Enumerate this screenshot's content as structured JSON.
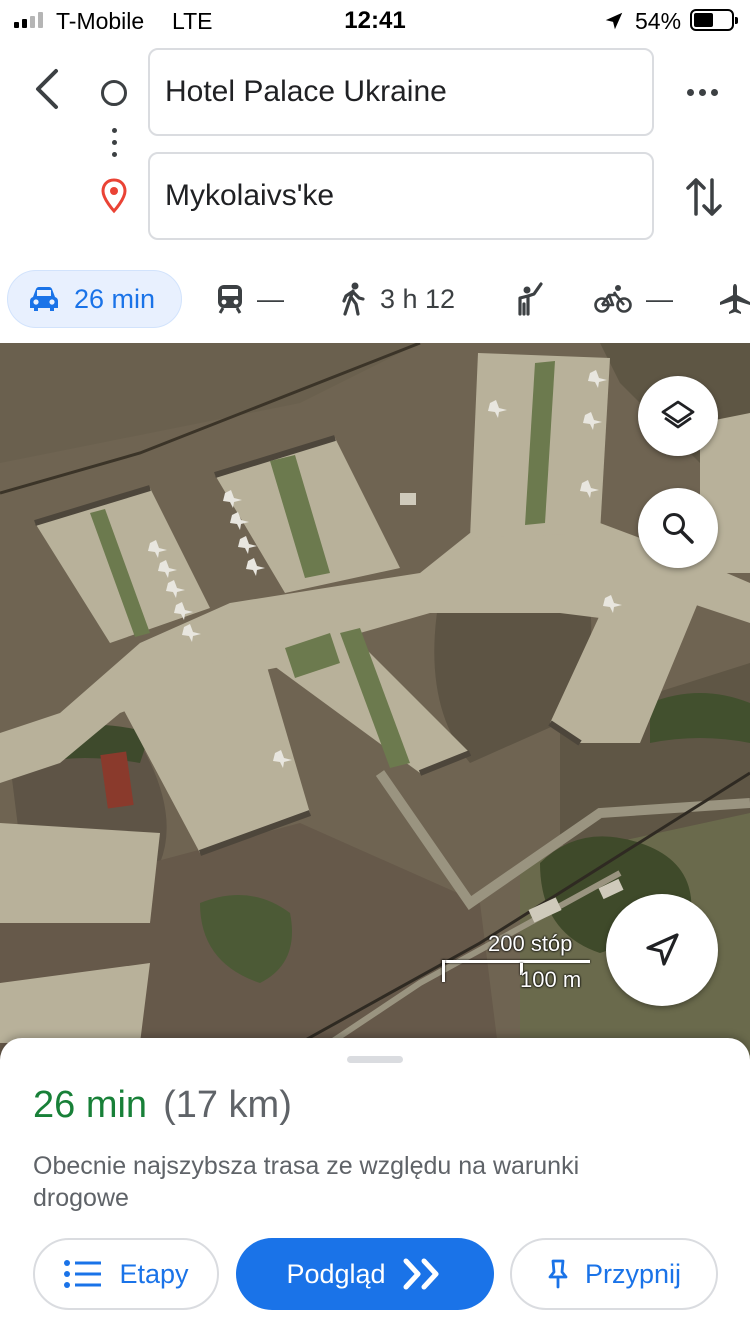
{
  "status_bar": {
    "carrier": "T-Mobile",
    "network": "LTE",
    "time": "12:41",
    "battery_percent": "54%",
    "battery_level": 0.54,
    "signal_bars": 2
  },
  "route": {
    "origin": "Hotel Palace Ukraine",
    "destination": "Mykolaivs'ke"
  },
  "travel_modes": {
    "driving": "26 min",
    "transit": "—",
    "walking": "3 h 12",
    "cycling": "—"
  },
  "map": {
    "type": "satellite",
    "scale_imperial": "200 stóp",
    "scale_metric": "100 m"
  },
  "summary": {
    "duration": "26 min",
    "distance": "(17 km)",
    "description": "Obecnie najszybsza trasa ze względu na warunki drogowe"
  },
  "actions": {
    "steps_label": "Etapy",
    "preview_label": "Podgląd",
    "pin_label": "Przypnij"
  },
  "colors": {
    "accent": "#1a73e8",
    "eta_green": "#188038",
    "pin_red": "#ea4335"
  }
}
